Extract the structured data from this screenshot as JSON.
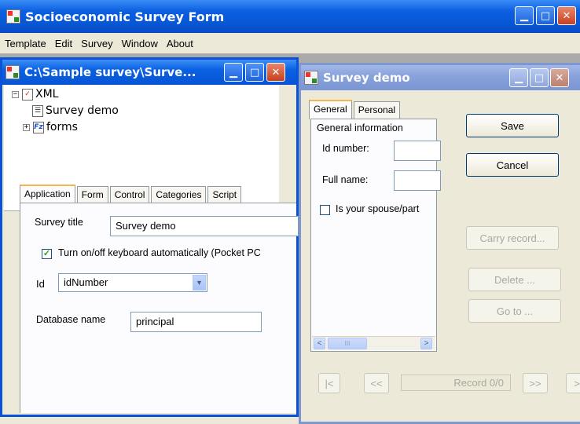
{
  "app": {
    "title": "Socioeconomic Survey Form",
    "minimize": "_",
    "maximize": "□",
    "close": "✕"
  },
  "menu": [
    "Template",
    "Edit",
    "Survey",
    "Window",
    "About"
  ],
  "template_window": {
    "title": "C:\\Sample survey\\Surve...",
    "tree": {
      "root": "XML",
      "child1": "Survey demo",
      "child2": "forms",
      "minus": "−",
      "plus": "+"
    },
    "tabs": [
      "Application",
      "Form",
      "Control",
      "Categories",
      "Script"
    ],
    "survey_title_label": "Survey title",
    "survey_title_value": "Survey demo",
    "keyboard_checkbox_label": "Turn on/off keyboard automatically (Pocket PC",
    "keyboard_checked": true,
    "id_label": "Id",
    "id_value": "idNumber",
    "db_label": "Database name",
    "db_value": "principal"
  },
  "survey_window": {
    "title": "Survey demo",
    "tabs": [
      "General",
      "Personal"
    ],
    "group_title": "General information",
    "id_label": "Id number:",
    "name_label": "Full name:",
    "spouse_label": "Is your spouse/part",
    "buttons": {
      "save": "Save",
      "cancel": "Cancel",
      "carry": "Carry record...",
      "delete": "Delete ...",
      "goto": "Go to ..."
    },
    "nav": {
      "first": "|<",
      "prev": "<<",
      "record": "Record 0/0",
      "next": ">>",
      "last": ">"
    },
    "scroll_left": "<",
    "scroll_right": ">",
    "scroll_thumb": "III"
  }
}
